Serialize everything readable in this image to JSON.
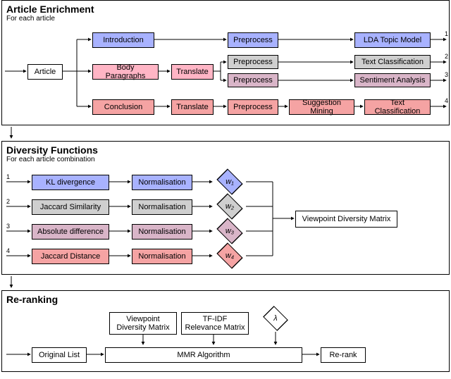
{
  "panel1": {
    "title": "Article Enrichment",
    "subtitle": "For each article",
    "article": "Article",
    "introduction": "Introduction",
    "body": "Body Paragraphs",
    "conclusion": "Conclusion",
    "translate": "Translate",
    "preprocess": "Preprocess",
    "lda": "LDA Topic Model",
    "textclass": "Text Classification",
    "sentiment": "Sentiment Analysis",
    "suggestion": "Suggestion Mining"
  },
  "panel2": {
    "title": "Diversity Functions",
    "subtitle": "For each article combination",
    "kl": "KL divergence",
    "jaccsim": "Jaccard Similarity",
    "absdiff": "Absolute difference",
    "jaccdist": "Jaccard Distance",
    "norm": "Normalisation",
    "w1": "w₁",
    "w2": "w₂",
    "w3": "w₃",
    "w4": "w₄",
    "vdm": "Viewpoint Diversity Matrix"
  },
  "panel3": {
    "title": "Re-ranking",
    "orig": "Original List",
    "vdm": "Viewpoint\nDiversity Matrix",
    "tfidf": "TF-IDF\nRelevance Matrix",
    "lambda": "λ",
    "mmr": "MMR Algorithm",
    "rerank": "Re-rank"
  },
  "outnums": {
    "n1": "1",
    "n2": "2",
    "n3": "3",
    "n4": "4"
  },
  "innums": {
    "n1": "1",
    "n2": "2",
    "n3": "3",
    "n4": "4"
  }
}
